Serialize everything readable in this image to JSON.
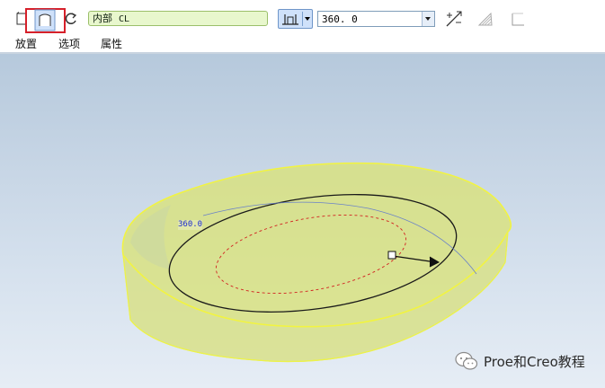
{
  "toolbar": {
    "icons": [
      "solid-icon",
      "surface-icon",
      "flip-direction-icon",
      "depth-icon",
      "remove-material-icon",
      "thicken-icon",
      "flat-sketch-icon"
    ],
    "reference_field": {
      "label": "内部",
      "value": "CL"
    },
    "angle_value": "360. 0",
    "highlight_color": "#d6202a"
  },
  "tabs": [
    {
      "label": "放置"
    },
    {
      "label": "选项"
    },
    {
      "label": "属性"
    }
  ],
  "viewport": {
    "dimension_label": "360.0",
    "model_color": "#e2ea70"
  },
  "watermark": {
    "text": "Proe和Creo教程"
  }
}
